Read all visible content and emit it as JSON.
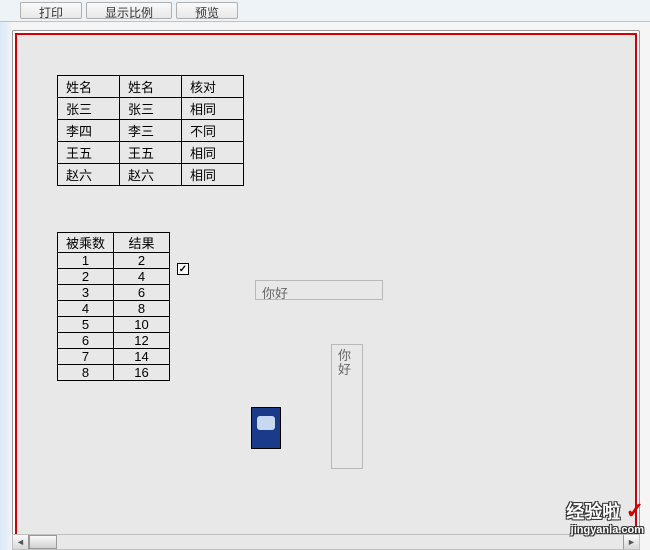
{
  "toolbar": {
    "print": "打印",
    "zoom": "显示比例",
    "preview": "预览"
  },
  "table1": {
    "headers": [
      "姓名",
      "姓名",
      "核对"
    ],
    "rows": [
      [
        "张三",
        "张三",
        "相同"
      ],
      [
        "李四",
        "李三",
        "不同"
      ],
      [
        "王五",
        "王五",
        "相同"
      ],
      [
        "赵六",
        "赵六",
        "相同"
      ]
    ]
  },
  "table2": {
    "headers": [
      "被乘数",
      "结果"
    ],
    "rows": [
      [
        "1",
        "2"
      ],
      [
        "2",
        "4"
      ],
      [
        "3",
        "6"
      ],
      [
        "4",
        "8"
      ],
      [
        "5",
        "10"
      ],
      [
        "6",
        "12"
      ],
      [
        "7",
        "14"
      ],
      [
        "8",
        "16"
      ]
    ]
  },
  "checkbox": {
    "checked": true,
    "glyph": "☑"
  },
  "textfields": {
    "horizontal": "你好",
    "vertical": "你好"
  },
  "watermark": {
    "title": "经验啦",
    "url": "jingyanla.com"
  },
  "chart_data": {
    "type": "table",
    "tables": [
      {
        "columns": [
          "姓名",
          "姓名",
          "核对"
        ],
        "rows": [
          [
            "张三",
            "张三",
            "相同"
          ],
          [
            "李四",
            "李三",
            "不同"
          ],
          [
            "王五",
            "王五",
            "相同"
          ],
          [
            "赵六",
            "赵六",
            "相同"
          ]
        ]
      },
      {
        "columns": [
          "被乘数",
          "结果"
        ],
        "rows": [
          [
            1,
            2
          ],
          [
            2,
            4
          ],
          [
            3,
            6
          ],
          [
            4,
            8
          ],
          [
            5,
            10
          ],
          [
            6,
            12
          ],
          [
            7,
            14
          ],
          [
            8,
            16
          ]
        ]
      }
    ]
  }
}
